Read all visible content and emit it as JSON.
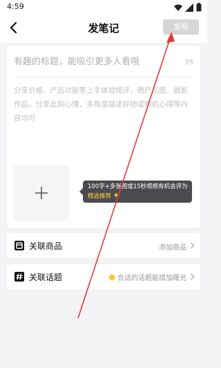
{
  "status": {
    "time": "4:59"
  },
  "header": {
    "title": "发笔记",
    "publish_label": "发布"
  },
  "editor": {
    "title_placeholder": "有趣的标题，能吸引更多人看哦",
    "title_count": "35",
    "body_placeholder": "分享价格、产品功能等上手体验短评，晒产品图、摄影作品，分享此刻心情，多角度描述好物或购机心得等内容均可",
    "tooltip_line1": "100字+多张图或15秒视频有机会评为",
    "tooltip_line2": "精选推荐"
  },
  "rows": {
    "products_label": "关联商品",
    "products_hint": "添加商品",
    "topics_label": "关联话题",
    "topics_hint": "合适的话题能增加曝光"
  },
  "colors": {
    "background": "#f3f3f5",
    "publish_disabled": "#d6d6d9",
    "tooltip_bg": "#4b4b4f",
    "highlight_yellow": "#ffd24a",
    "annotation_red": "#e53935"
  },
  "icons": [
    "back-arrow-icon",
    "wifi-icon",
    "signal-icon",
    "battery-icon",
    "plus-icon",
    "sparkle-icon",
    "product-box-icon",
    "hashtag-icon",
    "coin-icon",
    "chevron-right-icon"
  ]
}
